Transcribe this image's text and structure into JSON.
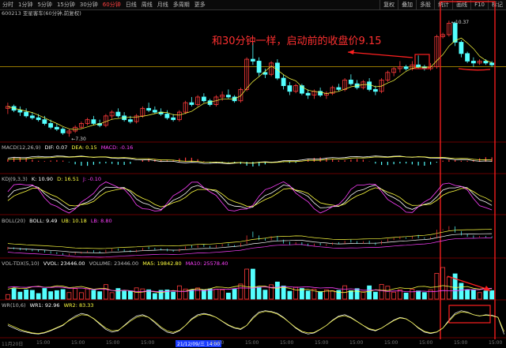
{
  "toolbar": {
    "items": [
      "分时",
      "1分钟",
      "5分钟",
      "15分钟",
      "30分钟",
      "60分钟",
      "日线",
      "周线",
      "月线",
      "多周期",
      "更多"
    ],
    "active_index": 5,
    "right_items": [
      "复权",
      "叠加",
      "多股",
      "统计",
      "画线",
      "F10",
      "标记"
    ]
  },
  "stock": {
    "code_name": "600213 亚星客车(60分钟,前复权)"
  },
  "price": {
    "high_label": "10.37",
    "low_label": "7.30"
  },
  "annotation": "和30分钟一样，启动前的收盘价9.15",
  "macd": {
    "name": "MACD(12,26,9)",
    "dif": "DIF: 0.07",
    "dea": "DEA: 0.15",
    "macd": "MACD: -0.16"
  },
  "kdj": {
    "name": "KDJ(9,3,3)",
    "k": "K: 10.90",
    "d": "D: 16.51",
    "j": "J: -0.10"
  },
  "boll": {
    "name": "BOLL(20)",
    "boll": "BOLL: 9.49",
    "ub": "UB: 10.18",
    "lb": "LB: 8.80"
  },
  "vol": {
    "name": "VOL-TDX(5,10)",
    "vvol": "VVOL: 23446.00",
    "volume": "VOLUME: 23446.00",
    "ma5": "MA5: 19842.80",
    "ma10": "MA10: 25578.40"
  },
  "wr": {
    "name": "WR(10,6)",
    "wr1": "WR1: 92.96",
    "wr2": "WR2: 83.33"
  },
  "axis": {
    "labels": [
      "11月20日",
      "15:00",
      "15:00",
      "15:00",
      "15:00",
      "21/12/09/三 14:00",
      "15:00",
      "15:00",
      "15:00",
      "15:00",
      "15:00",
      "15:00",
      "15:00",
      "15:00",
      "15:00"
    ],
    "date_index": 5
  },
  "colors": {
    "up": "#ff3b3b",
    "down": "#54ffff",
    "yellow": "#ffff40",
    "white": "#ffffff",
    "magenta": "#ff40ff",
    "annot_red": "#ff2020"
  },
  "chart_data": {
    "type": "candlestick",
    "price_range": [
      7.2,
      10.5
    ],
    "reference_price": 9.15,
    "candles": [
      {
        "o": 8.05,
        "h": 8.2,
        "l": 7.9,
        "c": 8.1
      },
      {
        "o": 8.1,
        "h": 8.15,
        "l": 7.95,
        "c": 8.0
      },
      {
        "o": 8.0,
        "h": 8.1,
        "l": 7.85,
        "c": 7.95
      },
      {
        "o": 7.95,
        "h": 8.05,
        "l": 7.8,
        "c": 7.85
      },
      {
        "o": 7.85,
        "h": 7.95,
        "l": 7.75,
        "c": 7.8
      },
      {
        "o": 7.8,
        "h": 7.9,
        "l": 7.7,
        "c": 7.75
      },
      {
        "o": 7.75,
        "h": 7.85,
        "l": 7.6,
        "c": 7.65
      },
      {
        "o": 7.65,
        "h": 7.75,
        "l": 7.5,
        "c": 7.55
      },
      {
        "o": 7.55,
        "h": 7.65,
        "l": 7.45,
        "c": 7.5
      },
      {
        "o": 7.5,
        "h": 7.55,
        "l": 7.35,
        "c": 7.4
      },
      {
        "o": 7.4,
        "h": 7.5,
        "l": 7.3,
        "c": 7.45
      },
      {
        "o": 7.45,
        "h": 7.6,
        "l": 7.4,
        "c": 7.55
      },
      {
        "o": 7.55,
        "h": 7.7,
        "l": 7.5,
        "c": 7.65
      },
      {
        "o": 7.65,
        "h": 7.8,
        "l": 7.6,
        "c": 7.75
      },
      {
        "o": 7.75,
        "h": 7.85,
        "l": 7.6,
        "c": 7.65
      },
      {
        "o": 7.65,
        "h": 7.75,
        "l": 7.55,
        "c": 7.6
      },
      {
        "o": 7.6,
        "h": 7.9,
        "l": 7.55,
        "c": 7.85
      },
      {
        "o": 7.85,
        "h": 8.0,
        "l": 7.75,
        "c": 7.95
      },
      {
        "o": 7.95,
        "h": 8.05,
        "l": 7.8,
        "c": 7.85
      },
      {
        "o": 7.85,
        "h": 7.95,
        "l": 7.7,
        "c": 7.75
      },
      {
        "o": 7.75,
        "h": 7.85,
        "l": 7.65,
        "c": 7.7
      },
      {
        "o": 7.7,
        "h": 7.9,
        "l": 7.65,
        "c": 7.85
      },
      {
        "o": 7.85,
        "h": 8.1,
        "l": 7.8,
        "c": 8.05
      },
      {
        "o": 8.05,
        "h": 8.2,
        "l": 7.95,
        "c": 8.0
      },
      {
        "o": 8.0,
        "h": 8.1,
        "l": 7.9,
        "c": 7.95
      },
      {
        "o": 7.95,
        "h": 8.05,
        "l": 7.85,
        "c": 7.9
      },
      {
        "o": 7.9,
        "h": 8.0,
        "l": 7.75,
        "c": 7.8
      },
      {
        "o": 7.8,
        "h": 7.9,
        "l": 7.7,
        "c": 7.75
      },
      {
        "o": 7.75,
        "h": 8.0,
        "l": 7.7,
        "c": 7.95
      },
      {
        "o": 7.95,
        "h": 8.25,
        "l": 7.9,
        "c": 8.2
      },
      {
        "o": 8.2,
        "h": 8.35,
        "l": 8.1,
        "c": 8.15
      },
      {
        "o": 8.15,
        "h": 8.4,
        "l": 8.1,
        "c": 8.35
      },
      {
        "o": 8.35,
        "h": 8.45,
        "l": 8.2,
        "c": 8.25
      },
      {
        "o": 8.25,
        "h": 8.3,
        "l": 8.1,
        "c": 8.15
      },
      {
        "o": 8.15,
        "h": 8.4,
        "l": 8.1,
        "c": 8.35
      },
      {
        "o": 8.35,
        "h": 8.5,
        "l": 8.25,
        "c": 8.4
      },
      {
        "o": 8.4,
        "h": 8.55,
        "l": 8.3,
        "c": 8.35
      },
      {
        "o": 8.35,
        "h": 8.4,
        "l": 8.2,
        "c": 8.25
      },
      {
        "o": 8.25,
        "h": 8.6,
        "l": 8.2,
        "c": 8.55
      },
      {
        "o": 8.55,
        "h": 9.4,
        "l": 8.5,
        "c": 9.35
      },
      {
        "o": 9.35,
        "h": 9.8,
        "l": 9.2,
        "c": 9.3
      },
      {
        "o": 9.3,
        "h": 9.4,
        "l": 8.9,
        "c": 9.0
      },
      {
        "o": 9.0,
        "h": 9.1,
        "l": 8.85,
        "c": 8.95
      },
      {
        "o": 8.95,
        "h": 9.3,
        "l": 8.9,
        "c": 9.25
      },
      {
        "o": 9.25,
        "h": 9.35,
        "l": 8.8,
        "c": 8.85
      },
      {
        "o": 8.85,
        "h": 8.95,
        "l": 8.55,
        "c": 8.65
      },
      {
        "o": 8.65,
        "h": 8.75,
        "l": 8.4,
        "c": 8.5
      },
      {
        "o": 8.5,
        "h": 8.7,
        "l": 8.45,
        "c": 8.65
      },
      {
        "o": 8.65,
        "h": 8.7,
        "l": 8.4,
        "c": 8.45
      },
      {
        "o": 8.45,
        "h": 8.55,
        "l": 8.3,
        "c": 8.4
      },
      {
        "o": 8.4,
        "h": 8.55,
        "l": 8.3,
        "c": 8.5
      },
      {
        "o": 8.5,
        "h": 8.6,
        "l": 8.35,
        "c": 8.4
      },
      {
        "o": 8.4,
        "h": 8.5,
        "l": 8.3,
        "c": 8.45
      },
      {
        "o": 8.45,
        "h": 8.65,
        "l": 8.4,
        "c": 8.6
      },
      {
        "o": 8.6,
        "h": 8.7,
        "l": 8.5,
        "c": 8.55
      },
      {
        "o": 8.55,
        "h": 8.85,
        "l": 8.5,
        "c": 8.8
      },
      {
        "o": 8.8,
        "h": 8.95,
        "l": 8.65,
        "c": 8.7
      },
      {
        "o": 8.7,
        "h": 8.8,
        "l": 8.55,
        "c": 8.6
      },
      {
        "o": 8.6,
        "h": 8.8,
        "l": 8.55,
        "c": 8.75
      },
      {
        "o": 8.75,
        "h": 8.85,
        "l": 8.5,
        "c": 8.55
      },
      {
        "o": 8.55,
        "h": 8.65,
        "l": 8.4,
        "c": 8.5
      },
      {
        "o": 8.5,
        "h": 8.85,
        "l": 8.45,
        "c": 8.8
      },
      {
        "o": 8.8,
        "h": 9.05,
        "l": 8.75,
        "c": 9.0
      },
      {
        "o": 9.0,
        "h": 9.15,
        "l": 8.9,
        "c": 9.1
      },
      {
        "o": 9.1,
        "h": 9.3,
        "l": 9.0,
        "c": 9.15
      },
      {
        "o": 9.15,
        "h": 9.2,
        "l": 9.05,
        "c": 9.1
      },
      {
        "o": 9.1,
        "h": 9.3,
        "l": 9.05,
        "c": 9.2
      },
      {
        "o": 9.2,
        "h": 9.45,
        "l": 9.1,
        "c": 9.15
      },
      {
        "o": 9.15,
        "h": 9.2,
        "l": 9.05,
        "c": 9.1
      },
      {
        "o": 9.1,
        "h": 9.25,
        "l": 9.05,
        "c": 9.15
      },
      {
        "o": 9.15,
        "h": 10.0,
        "l": 9.1,
        "c": 9.95
      },
      {
        "o": 9.95,
        "h": 10.05,
        "l": 9.9,
        "c": 10.0
      },
      {
        "o": 10.0,
        "h": 10.37,
        "l": 9.95,
        "c": 10.3
      },
      {
        "o": 10.3,
        "h": 10.35,
        "l": 9.7,
        "c": 9.8
      },
      {
        "o": 9.8,
        "h": 9.85,
        "l": 9.4,
        "c": 9.5
      },
      {
        "o": 9.5,
        "h": 9.55,
        "l": 9.25,
        "c": 9.3
      },
      {
        "o": 9.3,
        "h": 9.4,
        "l": 9.15,
        "c": 9.25
      },
      {
        "o": 9.25,
        "h": 9.35,
        "l": 9.2,
        "c": 9.3
      },
      {
        "o": 9.3,
        "h": 9.35,
        "l": 9.2,
        "c": 9.25
      },
      {
        "o": 9.25,
        "h": 9.3,
        "l": 9.15,
        "c": 9.2
      }
    ],
    "wr1": [
      60,
      70,
      80,
      85,
      90,
      92,
      88,
      80,
      70,
      60,
      40,
      25,
      15,
      20,
      35,
      55,
      75,
      85,
      80,
      60,
      40,
      25,
      20,
      30,
      50,
      70,
      85,
      90,
      80,
      60,
      35,
      20,
      15,
      20,
      30,
      45,
      60,
      70,
      75,
      60,
      30,
      10,
      5,
      8,
      15,
      30,
      50,
      70,
      85,
      92,
      88,
      75,
      60,
      40,
      25,
      20,
      30,
      45,
      60,
      75,
      80,
      70,
      55,
      40,
      30,
      35,
      50,
      70,
      85,
      90,
      85,
      70,
      40,
      15,
      5,
      10,
      20,
      25,
      20,
      22,
      30,
      93
    ],
    "wr2": [
      55,
      65,
      75,
      82,
      88,
      90,
      86,
      78,
      68,
      58,
      42,
      30,
      20,
      22,
      34,
      52,
      70,
      80,
      78,
      62,
      44,
      30,
      24,
      30,
      46,
      66,
      80,
      86,
      78,
      60,
      38,
      24,
      18,
      22,
      30,
      44,
      58,
      68,
      72,
      60,
      34,
      14,
      8,
      10,
      18,
      32,
      50,
      68,
      82,
      88,
      86,
      74,
      60,
      42,
      28,
      24,
      32,
      46,
      60,
      72,
      78,
      70,
      56,
      42,
      32,
      36,
      50,
      68,
      82,
      88,
      84,
      70,
      44,
      20,
      10,
      12,
      20,
      24,
      22,
      24,
      30,
      83
    ]
  }
}
